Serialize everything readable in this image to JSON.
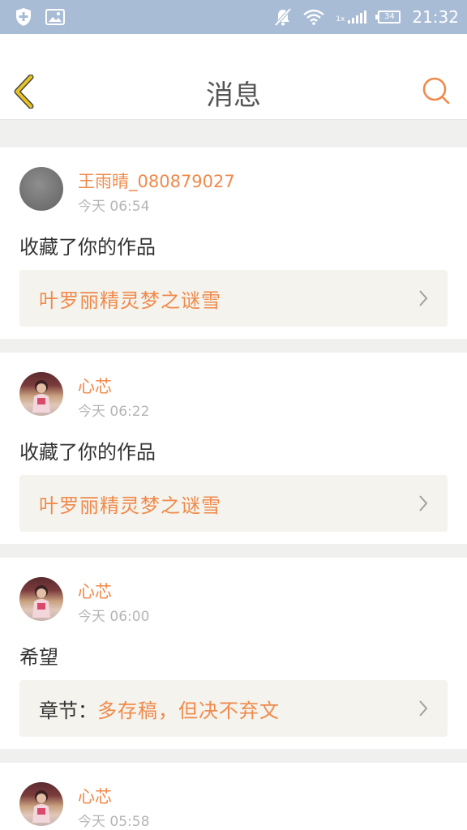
{
  "status_bar": {
    "time": "21:32",
    "battery": "34",
    "network": "1x",
    "icons": [
      "shield-plus-icon",
      "image-icon",
      "mute-icon",
      "wifi-icon",
      "signal-icon",
      "battery-icon"
    ]
  },
  "header": {
    "title": "消息",
    "back_icon": "chevron-left-icon",
    "search_icon": "search-icon"
  },
  "colors": {
    "accent": "#f08a4b",
    "back_icon": "#e8c21f",
    "status_bar": "#a9bcd6",
    "link_box": "#f4f3ed"
  },
  "messages": [
    {
      "username": "王雨晴_080879027",
      "time": "今天 06:54",
      "action": "收藏了你的作品",
      "link_prefix": "",
      "link_title": "叶罗丽精灵梦之谜雪"
    },
    {
      "username": "心芯",
      "time": "今天 06:22",
      "action": "收藏了你的作品",
      "link_prefix": "",
      "link_title": "叶罗丽精灵梦之谜雪"
    },
    {
      "username": "心芯",
      "time": "今天 06:00",
      "action": "希望",
      "link_prefix": "章节：",
      "link_title": "多存稿，但决不弃文"
    },
    {
      "username": "心芯",
      "time": "今天 05:58",
      "action": "",
      "link_prefix": "",
      "link_title": ""
    }
  ]
}
